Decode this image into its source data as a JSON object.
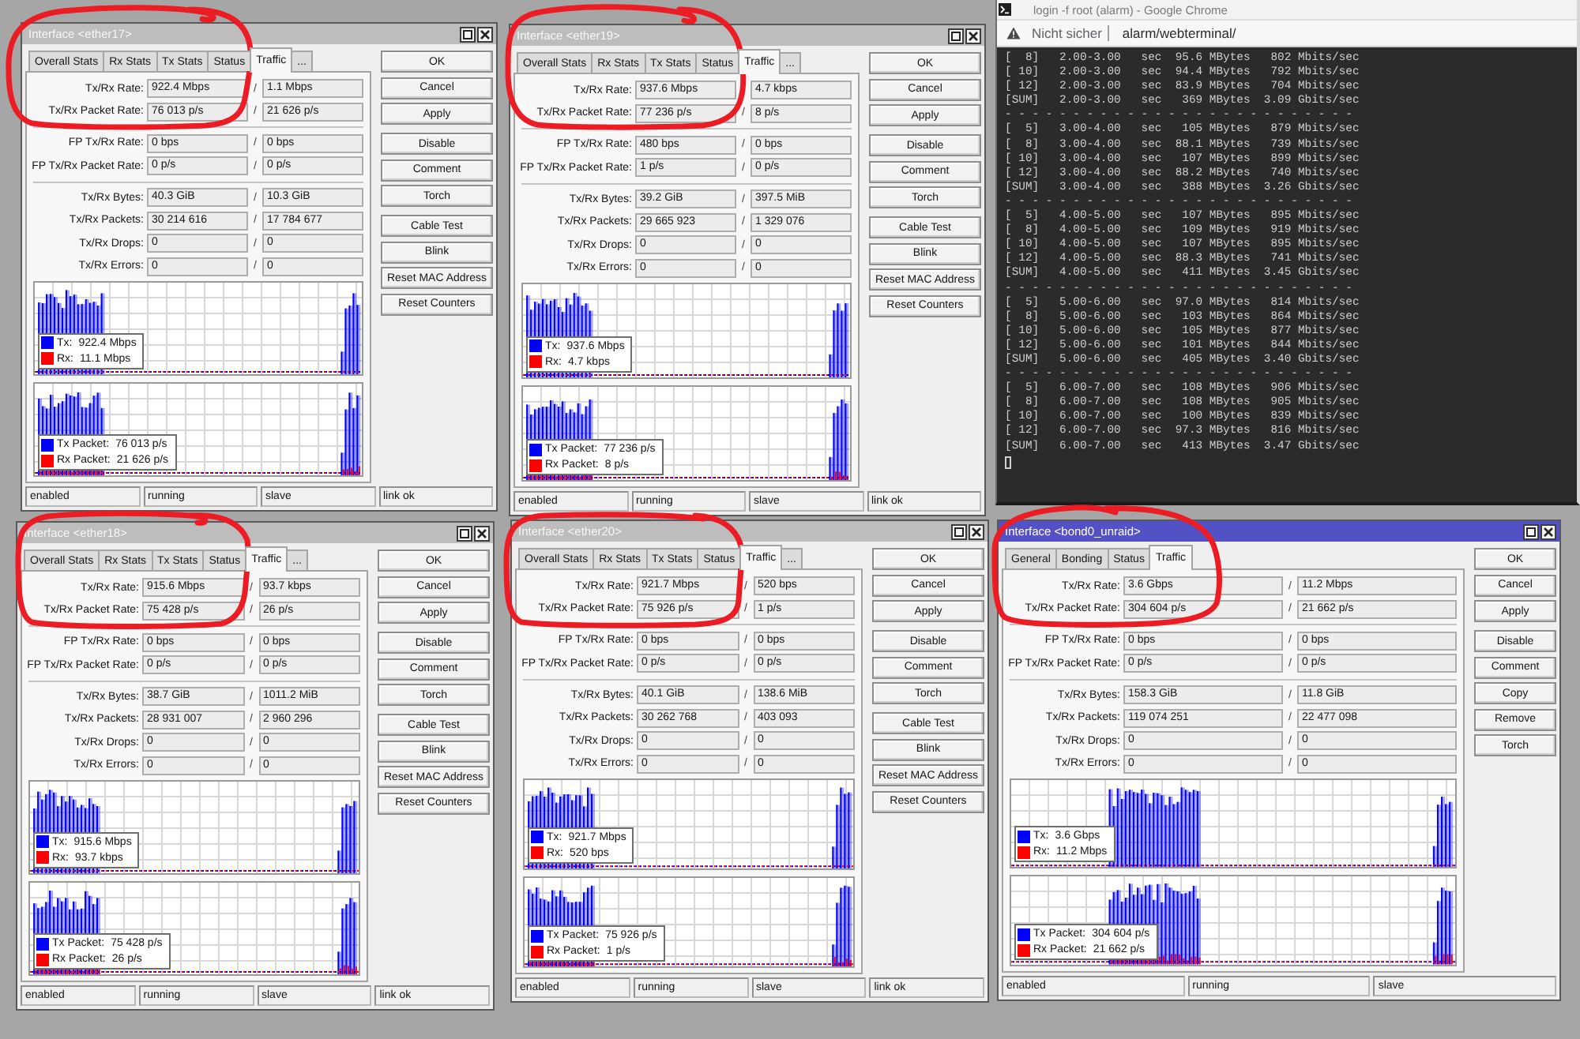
{
  "windows": [
    {
      "title": "Interface <ether17>",
      "active": false,
      "kind": "ethernet",
      "tabs": [
        {
          "label": "Overall Stats",
          "selected": false
        },
        {
          "label": "Rx Stats",
          "selected": false
        },
        {
          "label": "Tx Stats",
          "selected": false
        },
        {
          "label": "Status",
          "selected": false
        },
        {
          "label": "Traffic",
          "selected": true
        },
        {
          "label": "...",
          "selected": false
        }
      ],
      "row_groups": [
        [
          {
            "label": "Tx/Rx Rate:",
            "tx": "922.4 Mbps",
            "divider": "/",
            "rx": "1.1 Mbps"
          },
          {
            "label": "Tx/Rx Packet Rate:",
            "tx": "76 013 p/s",
            "divider": "/",
            "rx": "21 626 p/s"
          }
        ],
        [
          {
            "label": "FP Tx/Rx Rate:",
            "tx": "0 bps",
            "divider": "/",
            "rx": "0 bps"
          },
          {
            "label": "FP Tx/Rx Packet Rate:",
            "tx": "0 p/s",
            "divider": "/",
            "rx": "0 p/s"
          }
        ],
        [
          {
            "label": "Tx/Rx Bytes:",
            "tx": "40.3 GiB",
            "divider": "/",
            "rx": "10.3 GiB"
          },
          {
            "label": "Tx/Rx Packets:",
            "tx": "30 214 616",
            "divider": "/",
            "rx": "17 784 677"
          },
          {
            "label": "Tx/Rx Drops:",
            "tx": "0",
            "divider": "/",
            "rx": "0"
          },
          {
            "label": "Tx/Rx Errors:",
            "tx": "0",
            "divider": "/",
            "rx": "0"
          }
        ]
      ],
      "graphs": [
        {
          "legend": [
            {
              "name": "Tx:",
              "value": "922.4 Mbps",
              "color": "#0000ff"
            },
            {
              "name": "Rx:",
              "value": "11.1 Mbps",
              "color": "#ff0000"
            }
          ]
        },
        {
          "legend": [
            {
              "name": "Tx Packet:",
              "value": "76 013 p/s",
              "color": "#0000ff"
            },
            {
              "name": "Rx Packet:",
              "value": "21 626 p/s",
              "color": "#ff0000"
            }
          ]
        }
      ],
      "button_groups": [
        [
          "OK",
          "Cancel",
          "Apply"
        ],
        [
          "Disable",
          "Comment",
          "Torch"
        ],
        [
          "Cable Test",
          "Blink",
          "Reset MAC Address",
          "Reset Counters"
        ]
      ],
      "status": [
        "enabled",
        "running",
        "slave",
        "link ok"
      ]
    },
    {
      "title": "Interface <ether19>",
      "active": false,
      "kind": "ethernet",
      "tabs": [
        {
          "label": "Overall Stats",
          "selected": false
        },
        {
          "label": "Rx Stats",
          "selected": false
        },
        {
          "label": "Tx Stats",
          "selected": false
        },
        {
          "label": "Status",
          "selected": false
        },
        {
          "label": "Traffic",
          "selected": true
        },
        {
          "label": "...",
          "selected": false
        }
      ],
      "row_groups": [
        [
          {
            "label": "Tx/Rx Rate:",
            "tx": "937.6 Mbps",
            "rx": "4.7 kbps"
          },
          {
            "label": "Tx/Rx Packet Rate:",
            "tx": "77 236 p/s",
            "divider": "/",
            "rx": "8 p/s"
          }
        ],
        [
          {
            "label": "FP Tx/Rx Rate:",
            "tx": "480 bps",
            "divider": "/",
            "rx": "0 bps"
          },
          {
            "label": "FP Tx/Rx Packet Rate:",
            "tx": "1 p/s",
            "divider": "/",
            "rx": "0 p/s"
          }
        ],
        [
          {
            "label": "Tx/Rx Bytes:",
            "tx": "39.2 GiB",
            "divider": "/",
            "rx": "397.5 MiB"
          },
          {
            "label": "Tx/Rx Packets:",
            "tx": "29 665 923",
            "divider": "/",
            "rx": "1 329 076"
          },
          {
            "label": "Tx/Rx Drops:",
            "tx": "0",
            "divider": "/",
            "rx": "0"
          },
          {
            "label": "Tx/Rx Errors:",
            "tx": "0",
            "divider": "/",
            "rx": "0"
          }
        ]
      ],
      "graphs": [
        {
          "legend": [
            {
              "name": "Tx:",
              "value": "937.6 Mbps",
              "color": "#0000ff"
            },
            {
              "name": "Rx:",
              "value": "4.7 kbps",
              "color": "#ff0000"
            }
          ]
        },
        {
          "legend": [
            {
              "name": "Tx Packet:",
              "value": "77 236 p/s",
              "color": "#0000ff"
            },
            {
              "name": "Rx Packet:",
              "value": "8 p/s",
              "color": "#ff0000"
            }
          ]
        }
      ],
      "button_groups": [
        [
          "OK",
          "Cancel",
          "Apply"
        ],
        [
          "Disable",
          "Comment",
          "Torch"
        ],
        [
          "Cable Test",
          "Blink",
          "Reset MAC Address",
          "Reset Counters"
        ]
      ],
      "status": [
        "enabled",
        "running",
        "slave",
        "link ok"
      ]
    },
    {
      "title": "Interface <ether18>",
      "active": false,
      "kind": "ethernet",
      "tabs": [
        {
          "label": "Overall Stats",
          "selected": false
        },
        {
          "label": "Rx Stats",
          "selected": false
        },
        {
          "label": "Tx Stats",
          "selected": false
        },
        {
          "label": "Status",
          "selected": false
        },
        {
          "label": "Traffic",
          "selected": true
        },
        {
          "label": "...",
          "selected": false
        }
      ],
      "row_groups": [
        [
          {
            "label": "Tx/Rx Rate:",
            "tx": "915.6 Mbps",
            "divider": "/",
            "rx": "93.7 kbps"
          },
          {
            "label": "Tx/Rx Packet Rate:",
            "tx": "75 428 p/s",
            "divider": "/",
            "rx": "26 p/s"
          }
        ],
        [
          {
            "label": "FP Tx/Rx Rate:",
            "tx": "0 bps",
            "divider": "/",
            "rx": "0 bps"
          },
          {
            "label": "FP Tx/Rx Packet Rate:",
            "tx": "0 p/s",
            "divider": "/",
            "rx": "0 p/s"
          }
        ],
        [
          {
            "label": "Tx/Rx Bytes:",
            "tx": "38.7 GiB",
            "divider": "/",
            "rx": "1011.2 MiB"
          },
          {
            "label": "Tx/Rx Packets:",
            "tx": "28 931 007",
            "divider": "/",
            "rx": "2 960 296"
          },
          {
            "label": "Tx/Rx Drops:",
            "tx": "0",
            "divider": "/",
            "rx": "0"
          },
          {
            "label": "Tx/Rx Errors:",
            "tx": "0",
            "divider": "/",
            "rx": "0"
          }
        ]
      ],
      "graphs": [
        {
          "legend": [
            {
              "name": "Tx:",
              "value": "915.6 Mbps",
              "color": "#0000ff"
            },
            {
              "name": "Rx:",
              "value": "93.7 kbps",
              "color": "#ff0000"
            }
          ]
        },
        {
          "legend": [
            {
              "name": "Tx Packet:",
              "value": "75 428 p/s",
              "color": "#0000ff"
            },
            {
              "name": "Rx Packet:",
              "value": "26 p/s",
              "color": "#ff0000"
            }
          ]
        }
      ],
      "button_groups": [
        [
          "OK",
          "Cancel",
          "Apply"
        ],
        [
          "Disable",
          "Comment",
          "Torch"
        ],
        [
          "Cable Test",
          "Blink",
          "Reset MAC Address",
          "Reset Counters"
        ]
      ],
      "status": [
        "enabled",
        "running",
        "slave",
        "link ok"
      ]
    },
    {
      "title": "Interface <ether20>",
      "active": false,
      "kind": "ethernet",
      "tabs": [
        {
          "label": "Overall Stats",
          "selected": false
        },
        {
          "label": "Rx Stats",
          "selected": false
        },
        {
          "label": "Tx Stats",
          "selected": false
        },
        {
          "label": "Status",
          "selected": false
        },
        {
          "label": "Traffic",
          "selected": true
        },
        {
          "label": "...",
          "selected": false
        }
      ],
      "row_groups": [
        [
          {
            "label": "Tx/Rx Rate:",
            "tx": "921.7 Mbps",
            "divider": "/",
            "rx": "520 bps"
          },
          {
            "label": "Tx/Rx Packet Rate:",
            "tx": "75 926 p/s",
            "divider": "/",
            "rx": "1 p/s"
          }
        ],
        [
          {
            "label": "FP Tx/Rx Rate:",
            "tx": "0 bps",
            "divider": "/",
            "rx": "0 bps"
          },
          {
            "label": "FP Tx/Rx Packet Rate:",
            "tx": "0 p/s",
            "divider": "/",
            "rx": "0 p/s"
          }
        ],
        [
          {
            "label": "Tx/Rx Bytes:",
            "tx": "40.1 GiB",
            "divider": "/",
            "rx": "138.6 MiB"
          },
          {
            "label": "Tx/Rx Packets:",
            "tx": "30 262 768",
            "divider": "/",
            "rx": "403 093"
          },
          {
            "label": "Tx/Rx Drops:",
            "tx": "0",
            "divider": "/",
            "rx": "0"
          },
          {
            "label": "Tx/Rx Errors:",
            "tx": "0",
            "divider": "/",
            "rx": "0"
          }
        ]
      ],
      "graphs": [
        {
          "legend": [
            {
              "name": "Tx:",
              "value": "921.7 Mbps",
              "color": "#0000ff"
            },
            {
              "name": "Rx:",
              "value": "520 bps",
              "color": "#ff0000"
            }
          ]
        },
        {
          "legend": [
            {
              "name": "Tx Packet:",
              "value": "75 926 p/s",
              "color": "#0000ff"
            },
            {
              "name": "Rx Packet:",
              "value": "1 p/s",
              "color": "#ff0000"
            }
          ]
        }
      ],
      "button_groups": [
        [
          "OK",
          "Cancel",
          "Apply"
        ],
        [
          "Disable",
          "Comment",
          "Torch"
        ],
        [
          "Cable Test",
          "Blink",
          "Reset MAC Address",
          "Reset Counters"
        ]
      ],
      "status": [
        "enabled",
        "running",
        "slave",
        "link ok"
      ]
    },
    {
      "title": "Interface <bond0_unraid>",
      "active": true,
      "kind": "bond",
      "tabs": [
        {
          "label": "General",
          "selected": false
        },
        {
          "label": "Bonding",
          "selected": false
        },
        {
          "label": "Status",
          "selected": false
        },
        {
          "label": "Traffic",
          "selected": true
        }
      ],
      "row_groups": [
        [
          {
            "label": "Tx/Rx Rate:",
            "tx": "3.6 Gbps",
            "divider": "/",
            "rx": "11.2 Mbps"
          },
          {
            "label": "Tx/Rx Packet Rate:",
            "tx": "304 604 p/s",
            "divider": "/",
            "rx": "21 662 p/s"
          }
        ],
        [
          {
            "label": "FP Tx/Rx Rate:",
            "tx": "0 bps",
            "divider": "/",
            "rx": "0 bps"
          },
          {
            "label": "FP Tx/Rx Packet Rate:",
            "tx": "0 p/s",
            "divider": "/",
            "rx": "0 p/s"
          }
        ],
        [
          {
            "label": "Tx/Rx Bytes:",
            "tx": "158.3 GiB",
            "divider": "/",
            "rx": "11.8 GiB"
          },
          {
            "label": "Tx/Rx Packets:",
            "tx": "119 074 251",
            "divider": "/",
            "rx": "22 477 098"
          },
          {
            "label": "Tx/Rx Drops:",
            "tx": "0",
            "divider": "/",
            "rx": "0"
          },
          {
            "label": "Tx/Rx Errors:",
            "tx": "0",
            "divider": "/",
            "rx": "0"
          }
        ]
      ],
      "graphs": [
        {
          "legend": [
            {
              "name": "Tx:",
              "value": "3.6 Gbps",
              "color": "#0000ff"
            },
            {
              "name": "Rx:",
              "value": "11.2 Mbps",
              "color": "#ff0000"
            }
          ]
        },
        {
          "legend": [
            {
              "name": "Tx Packet:",
              "value": "304 604 p/s",
              "color": "#0000ff"
            },
            {
              "name": "Rx Packet:",
              "value": "21 662 p/s",
              "color": "#ff0000"
            }
          ]
        }
      ],
      "button_groups": [
        [
          "OK",
          "Cancel",
          "Apply"
        ],
        [
          "Disable",
          "Comment",
          "Copy",
          "Remove",
          "Torch"
        ]
      ],
      "status": [
        "enabled",
        "running",
        "slave"
      ]
    }
  ],
  "browser": {
    "title": "login -f root (alarm) - Google Chrome",
    "security": "Nicht sicher",
    "url": "alarm/webterminal/",
    "terminal_lines": [
      "[  8]   2.00-3.00   sec  95.6 MBytes   802 Mbits/sec",
      "[ 10]   2.00-3.00   sec  94.4 MBytes   792 Mbits/sec",
      "[ 12]   2.00-3.00   sec  83.9 MBytes   704 Mbits/sec",
      "[SUM]   2.00-3.00   sec   369 MBytes  3.09 Gbits/sec",
      "- - - - - - - - - - - - - - - - - - - - - - - - - -",
      "[  5]   3.00-4.00   sec   105 MBytes   879 Mbits/sec",
      "[  8]   3.00-4.00   sec  88.1 MBytes   739 Mbits/sec",
      "[ 10]   3.00-4.00   sec   107 MBytes   899 Mbits/sec",
      "[ 12]   3.00-4.00   sec  88.2 MBytes   740 Mbits/sec",
      "[SUM]   3.00-4.00   sec   388 MBytes  3.26 Gbits/sec",
      "- - - - - - - - - - - - - - - - - - - - - - - - - -",
      "[  5]   4.00-5.00   sec   107 MBytes   895 Mbits/sec",
      "[  8]   4.00-5.00   sec   109 MBytes   919 Mbits/sec",
      "[ 10]   4.00-5.00   sec   107 MBytes   895 Mbits/sec",
      "[ 12]   4.00-5.00   sec  88.3 MBytes   741 Mbits/sec",
      "[SUM]   4.00-5.00   sec   411 MBytes  3.45 Gbits/sec",
      "- - - - - - - - - - - - - - - - - - - - - - - - - -",
      "[  5]   5.00-6.00   sec  97.0 MBytes   814 Mbits/sec",
      "[  8]   5.00-6.00   sec   103 MBytes   864 Mbits/sec",
      "[ 10]   5.00-6.00   sec   105 MBytes   877 Mbits/sec",
      "[ 12]   5.00-6.00   sec   101 MBytes   844 Mbits/sec",
      "[SUM]   5.00-6.00   sec   405 MBytes  3.40 Gbits/sec",
      "- - - - - - - - - - - - - - - - - - - - - - - - - -",
      "[  5]   6.00-7.00   sec   108 MBytes   906 Mbits/sec",
      "[  8]   6.00-7.00   sec   108 MBytes   905 Mbits/sec",
      "[ 10]   6.00-7.00   sec   100 MBytes   839 Mbits/sec",
      "[ 12]   6.00-7.00   sec  97.3 MBytes   816 Mbits/sec",
      "[SUM]   6.00-7.00   sec   413 MBytes  3.47 Gbits/sec"
    ]
  }
}
